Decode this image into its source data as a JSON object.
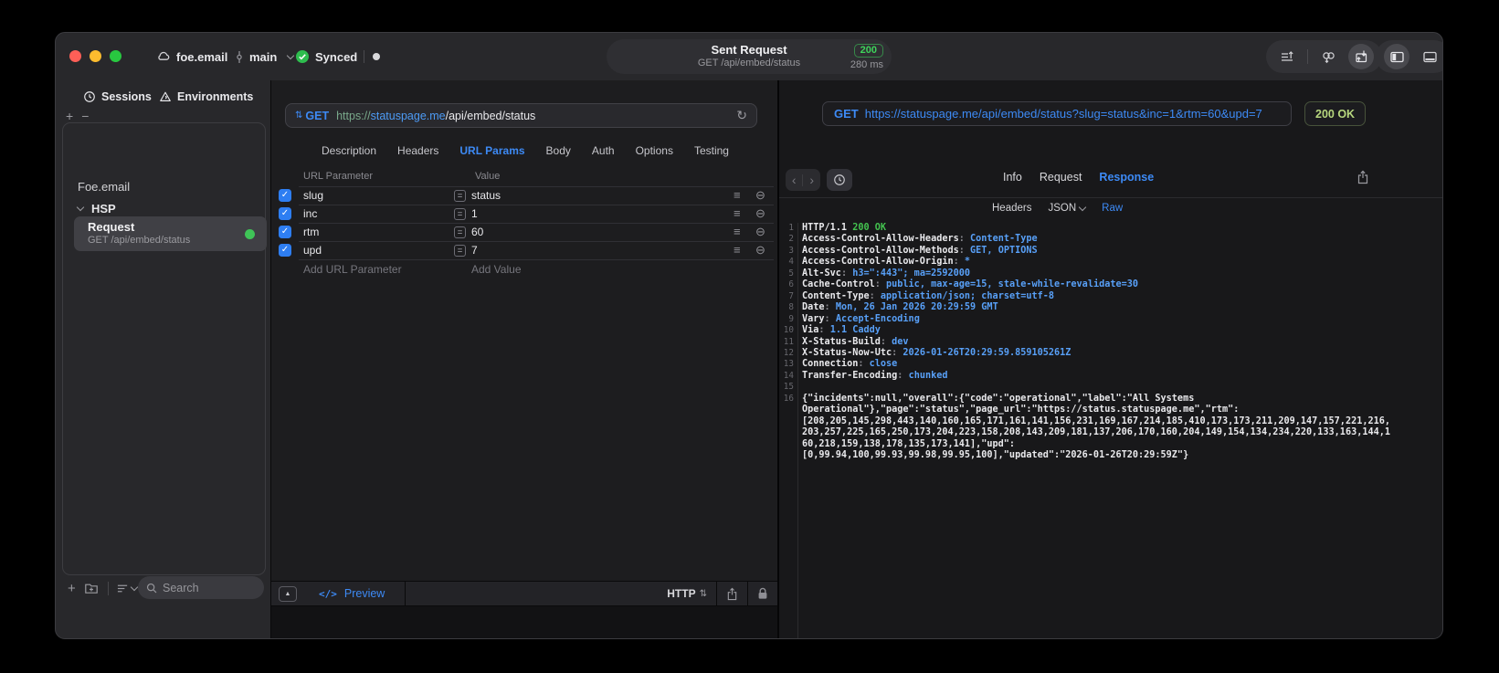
{
  "icons": {
    "check": "✓",
    "plus": "+",
    "minus": "−",
    "equals": "=",
    "hamburger": "≡",
    "minus_circle": "⊖",
    "reload": "↻",
    "collapse_triangle": "▲",
    "updown_arrows": "⇅",
    "angle_left": "‹",
    "angle_right": "›"
  },
  "colors": {
    "accent": "#3d8af5",
    "sync_green": "#2ebd4e",
    "status_green": "#3ed45b",
    "response_ok_green": "#43c24f",
    "value_blue": "#58a0f8",
    "badge_green": "#b7d77e"
  },
  "titlebar": {
    "project": "foe.email",
    "branch": "main",
    "sync_label": "Synced",
    "pill": {
      "title": "Sent Request",
      "subtitle": "GET /api/embed/status",
      "status": "200",
      "time": "280 ms"
    }
  },
  "sidebar": {
    "tabs": [
      {
        "label": "Sessions"
      },
      {
        "label": "Environments"
      }
    ],
    "tree": [
      {
        "label": "Foe.email"
      },
      {
        "label": "HSP"
      }
    ],
    "request_item": {
      "title": "Request",
      "subtitle": "GET /api/embed/status"
    },
    "search_placeholder": "Search"
  },
  "request_panel": {
    "method": "GET",
    "url": {
      "scheme": "https",
      "sep": "://",
      "host": "statuspage.me",
      "path": "/api/embed/status"
    },
    "tabs": [
      "Description",
      "Headers",
      "URL Params",
      "Body",
      "Auth",
      "Options",
      "Testing"
    ],
    "active_tab": "URL Params",
    "table": {
      "col_name": "URL Parameter",
      "col_value": "Value",
      "rows": [
        {
          "enabled": true,
          "name": "slug",
          "value": "status"
        },
        {
          "enabled": true,
          "name": "inc",
          "value": "1"
        },
        {
          "enabled": true,
          "name": "rtm",
          "value": "60"
        },
        {
          "enabled": true,
          "name": "upd",
          "value": "7"
        }
      ],
      "add_name": "Add URL Parameter",
      "add_value": "Add Value"
    },
    "footer": {
      "code_glyph": "</>",
      "preview": "Preview",
      "protocol": "HTTP"
    }
  },
  "response_panel": {
    "method": "GET",
    "url": "https://statuspage.me/api/embed/status?slug=status&inc=1&rtm=60&upd=7",
    "status": "200 OK",
    "tabs": [
      "Info",
      "Request",
      "Response"
    ],
    "active_tab": "Response",
    "subtabs": [
      "Headers",
      "JSON",
      "Raw"
    ],
    "active_subtab": "Raw",
    "lines": [
      {
        "n": 1,
        "parts": [
          {
            "t": "HTTP/1.1 ",
            "c": "w"
          },
          {
            "t": "200 OK",
            "c": "g"
          }
        ]
      },
      {
        "n": 2,
        "parts": [
          {
            "t": "Access-Control-Allow-Headers",
            "c": "w"
          },
          {
            "t": ": ",
            "c": "p"
          },
          {
            "t": "Content-Type",
            "c": "b"
          }
        ]
      },
      {
        "n": 3,
        "parts": [
          {
            "t": "Access-Control-Allow-Methods",
            "c": "w"
          },
          {
            "t": ": ",
            "c": "p"
          },
          {
            "t": "GET, OPTIONS",
            "c": "b"
          }
        ]
      },
      {
        "n": 4,
        "parts": [
          {
            "t": "Access-Control-Allow-Origin",
            "c": "w"
          },
          {
            "t": ": ",
            "c": "p"
          },
          {
            "t": "*",
            "c": "b"
          }
        ]
      },
      {
        "n": 5,
        "parts": [
          {
            "t": "Alt-Svc",
            "c": "w"
          },
          {
            "t": ": ",
            "c": "p"
          },
          {
            "t": "h3=\":443\"; ma=2592000",
            "c": "b"
          }
        ]
      },
      {
        "n": 6,
        "parts": [
          {
            "t": "Cache-Control",
            "c": "w"
          },
          {
            "t": ": ",
            "c": "p"
          },
          {
            "t": "public, max-age=15, stale-while-revalidate=30",
            "c": "b"
          }
        ]
      },
      {
        "n": 7,
        "parts": [
          {
            "t": "Content-Type",
            "c": "w"
          },
          {
            "t": ": ",
            "c": "p"
          },
          {
            "t": "application/json; charset=utf-8",
            "c": "b"
          }
        ]
      },
      {
        "n": 8,
        "parts": [
          {
            "t": "Date",
            "c": "w"
          },
          {
            "t": ": ",
            "c": "p"
          },
          {
            "t": "Mon, 26 Jan 2026 20:29:59 GMT",
            "c": "b"
          }
        ]
      },
      {
        "n": 9,
        "parts": [
          {
            "t": "Vary",
            "c": "w"
          },
          {
            "t": ": ",
            "c": "p"
          },
          {
            "t": "Accept-Encoding",
            "c": "b"
          }
        ]
      },
      {
        "n": 10,
        "parts": [
          {
            "t": "Via",
            "c": "w"
          },
          {
            "t": ": ",
            "c": "p"
          },
          {
            "t": "1.1 Caddy",
            "c": "b"
          }
        ]
      },
      {
        "n": 11,
        "parts": [
          {
            "t": "X-Status-Build",
            "c": "w"
          },
          {
            "t": ": ",
            "c": "p"
          },
          {
            "t": "dev",
            "c": "b"
          }
        ]
      },
      {
        "n": 12,
        "parts": [
          {
            "t": "X-Status-Now-Utc",
            "c": "w"
          },
          {
            "t": ": ",
            "c": "p"
          },
          {
            "t": "2026-01-26T20:29:59.859105261Z",
            "c": "b"
          }
        ]
      },
      {
        "n": 13,
        "parts": [
          {
            "t": "Connection",
            "c": "w"
          },
          {
            "t": ": ",
            "c": "p"
          },
          {
            "t": "close",
            "c": "b"
          }
        ]
      },
      {
        "n": 14,
        "parts": [
          {
            "t": "Transfer-Encoding",
            "c": "w"
          },
          {
            "t": ": ",
            "c": "p"
          },
          {
            "t": "chunked",
            "c": "b"
          }
        ]
      },
      {
        "n": 15,
        "parts": []
      },
      {
        "n": 16,
        "parts": [
          {
            "t": "{\"incidents\":null,\"overall\":{\"code\":\"operational\",\"label\":\"All Systems\nOperational\"},\"page\":\"status\",\"page_url\":\"https://status.statuspage.me\",\"rtm\":\n[208,205,145,298,443,140,160,165,171,161,141,156,231,169,167,214,185,410,173,173,211,209,147,157,221,216,\n203,257,225,165,250,173,204,223,158,208,143,209,181,137,206,170,160,204,149,154,134,234,220,133,163,144,1\n60,218,159,138,178,135,173,141],\"upd\":\n[0,99.94,100,99.93,99.98,99.95,100],\"updated\":\"2026-01-26T20:29:59Z\"}",
            "c": "w"
          }
        ]
      }
    ]
  }
}
